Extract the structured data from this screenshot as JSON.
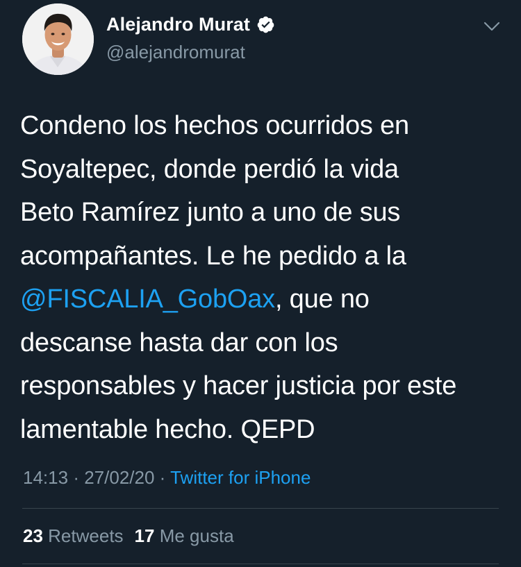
{
  "author": {
    "name": "Alejandro Murat",
    "handle": "@alejandromurat",
    "verified": true,
    "avatar_icon": "profile-photo-icon"
  },
  "tweet": {
    "lines": [
      {
        "text": "Condeno los hechos ocurridos en"
      },
      {
        "text": "Soyaltepec, donde perdió la vida"
      },
      {
        "text": "Beto Ramírez junto a uno de sus"
      },
      {
        "text": "acompañantes. Le he pedido a la"
      },
      {
        "mention": "@FISCALIA_GobOax",
        "after": ", que no"
      },
      {
        "text": "descanse hasta dar con los"
      },
      {
        "text": "responsables y hacer justicia por este"
      },
      {
        "text": "lamentable hecho. QEPD"
      }
    ],
    "time": "14:13",
    "separator": "·",
    "date": "27/02/20",
    "source": "Twitter for iPhone"
  },
  "stats": {
    "retweets_count": "23",
    "retweets_label": "Retweets",
    "likes_count": "17",
    "likes_label": "Me gusta"
  },
  "colors": {
    "background": "#15202b",
    "text": "#ffffff",
    "secondary": "#8899a6",
    "accent": "#1da1f2",
    "divider": "#38444d"
  },
  "icons": {
    "verified": "verified-badge-icon",
    "menu": "chevron-down-icon"
  }
}
